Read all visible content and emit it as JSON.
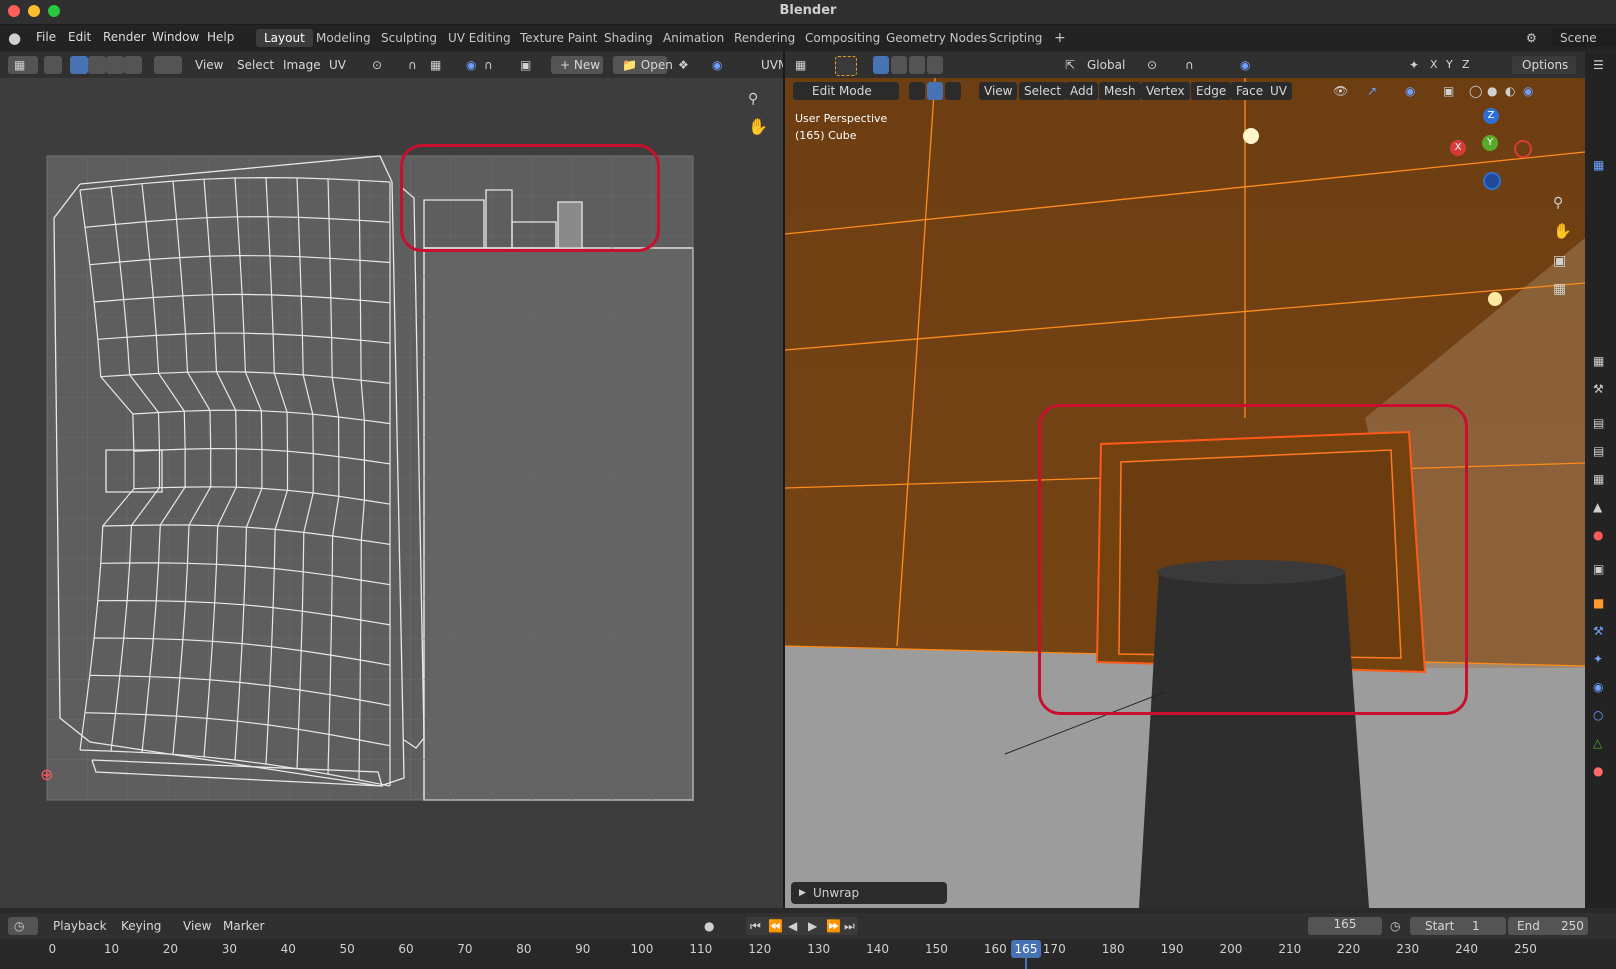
{
  "window": {
    "title": "Blender"
  },
  "top_menu": [
    "File",
    "Edit",
    "Render",
    "Window",
    "Help"
  ],
  "workspace_tabs": [
    "Layout",
    "Modeling",
    "Sculpting",
    "UV Editing",
    "Texture Paint",
    "Shading",
    "Animation",
    "Rendering",
    "Compositing",
    "Geometry Nodes",
    "Scripting"
  ],
  "active_workspace": "Layout",
  "scene_name": "Scene",
  "uv_editor": {
    "menus": [
      "View",
      "Select",
      "Image",
      "UV"
    ],
    "new_label": "New",
    "open_label": "Open",
    "uvmap_label": "UVM"
  },
  "viewport": {
    "mode": "Edit Mode",
    "menus": [
      "View",
      "Select",
      "Add",
      "Mesh",
      "Vertex",
      "Edge",
      "Face",
      "UV"
    ],
    "orientation": "Global",
    "options_label": "Options",
    "overlay_title": "User Perspective",
    "overlay_object": "(165) Cube",
    "operator_panel": "Unwrap",
    "axes": {
      "x": "X",
      "y": "Y",
      "z": "Z"
    }
  },
  "timeline": {
    "menus": [
      "Playback",
      "Keying",
      "View",
      "Marker"
    ],
    "current_frame": "165",
    "start_label": "Start",
    "start_value": "1",
    "end_label": "End",
    "end_value": "250",
    "ticks": [
      "0",
      "10",
      "20",
      "30",
      "40",
      "50",
      "60",
      "70",
      "80",
      "90",
      "100",
      "110",
      "120",
      "130",
      "140",
      "150",
      "160",
      "170",
      "180",
      "190",
      "200",
      "210",
      "220",
      "230",
      "240",
      "250"
    ]
  },
  "colors": {
    "accent": "#4772b3",
    "highlight_box": "#c8102e",
    "selection_orange": "#ff8c1a"
  }
}
